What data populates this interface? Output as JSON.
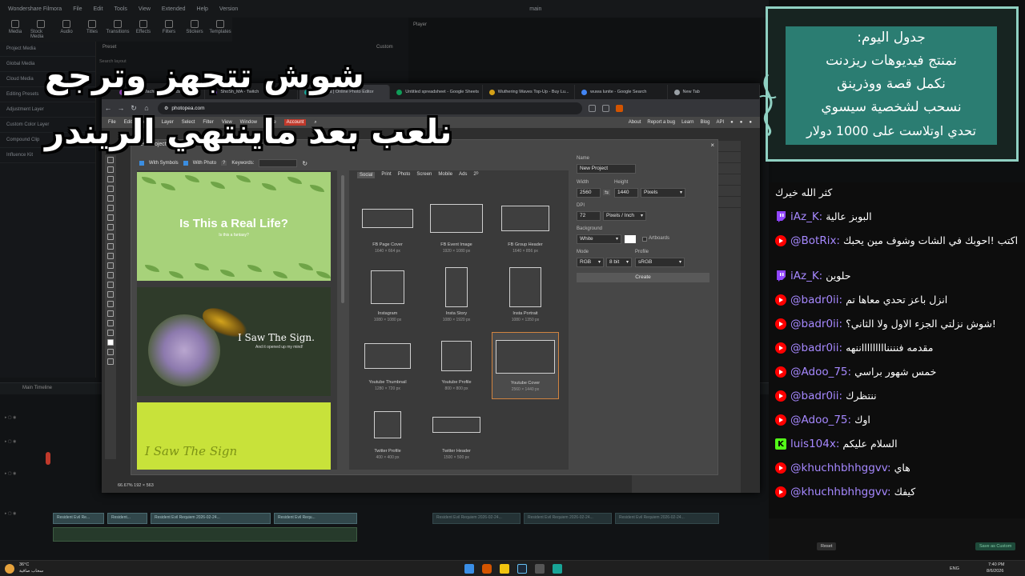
{
  "filmora": {
    "app_name": "Wondershare Filmora",
    "menu": [
      "File",
      "Edit",
      "Tools",
      "View",
      "Extended",
      "Help",
      "Version"
    ],
    "project": "main",
    "tools": [
      "Media",
      "Stock Media",
      "Audio",
      "Titles",
      "Transitions",
      "Effects",
      "Filters",
      "Stickers",
      "Templates"
    ],
    "left_items": [
      "Project Media",
      "Global Media",
      "Cloud Media",
      "Editing Presets",
      "Adjustment Layer",
      "Custom Color Layer",
      "Compound Clip",
      "Influence Kit"
    ],
    "player_label": "Player",
    "preset_label": "Preset",
    "custom_label": "Custom",
    "search_placeholder": "Search layout",
    "timeline_label": "Main Timeline",
    "clips": [
      "Resident Evil Re...",
      "Resident...",
      "Resident Evil Requiem 2026-02-24...",
      "Resident Evil Requ..."
    ],
    "render_button": "Save as Custom",
    "reset_button": "Reset"
  },
  "browser": {
    "tabs": [
      {
        "label": "Loyalty Machine — Clouds...",
        "color": "#8e44ad"
      },
      {
        "label": "ShoSh_MA - Twitch",
        "color": "#9146ff"
      },
      {
        "label": "Photopea | Online Photo Editor",
        "color": "#18a497"
      },
      {
        "label": "Untitled spreadsheet - Google Sheets",
        "color": "#0f9d58"
      },
      {
        "label": "Wuthering Waves Top-Up - Buy Lu...",
        "color": "#d4a017"
      },
      {
        "label": "wuwa lunite - Google Search",
        "color": "#4285f4"
      },
      {
        "label": "New Tab",
        "color": "#9aa0a6"
      }
    ],
    "url": "photopea.com"
  },
  "photopea": {
    "menu": [
      "File",
      "Edit",
      "Image",
      "Layer",
      "Select",
      "Filter",
      "View",
      "Window",
      "More"
    ],
    "account": "Account",
    "right_links": [
      "About",
      "Report a bug",
      "Learn",
      "Blog",
      "API"
    ],
    "status": "66.67%   192 × 563",
    "dialog": {
      "title": "New Project",
      "opt_symbols": "With Symbols",
      "opt_photo": "With Photo",
      "opt_help": "?",
      "keywords_label": "Keywords:",
      "categories": [
        "Social",
        "Print",
        "Photo",
        "Screen",
        "Mobile",
        "Ads",
        "2ᴰ"
      ],
      "templates": [
        {
          "title": "Is This a Real Life?",
          "subtitle": "Is this a fantasy?"
        },
        {
          "title": "I Saw The Sign.",
          "subtitle": "And it opened up my mind!"
        },
        {
          "title": "I Saw The Sign"
        }
      ],
      "presets": [
        {
          "name": "FB Page Cover",
          "size": "1640 × 664 px"
        },
        {
          "name": "FB Event Image",
          "size": "1920 × 1080 px"
        },
        {
          "name": "FB Group Header",
          "size": "1640 × 856 px"
        },
        {
          "name": "Instagram",
          "size": "1080 × 1080 px"
        },
        {
          "name": "Insta Story",
          "size": "1080 × 1920 px"
        },
        {
          "name": "Insta Portrait",
          "size": "1080 × 1350 px"
        },
        {
          "name": "Youtube Thumbnail",
          "size": "1280 × 720 px"
        },
        {
          "name": "Youtube Profile",
          "size": "800 × 800 px"
        },
        {
          "name": "Youtube Cover",
          "size": "2560 × 1440 px"
        },
        {
          "name": "Twitter Profile",
          "size": "400 × 400 px"
        },
        {
          "name": "Twitter Header",
          "size": "1500 × 500 px"
        }
      ],
      "form": {
        "name_label": "Name",
        "name_value": "New Project",
        "width_label": "Width",
        "width_value": "2560",
        "height_label": "Height",
        "height_value": "1440",
        "unit": "Pixels",
        "dpi_label": "DPI",
        "dpi_value": "72",
        "dpi_unit": "Pixels / Inch",
        "bg_label": "Background",
        "bg_value": "White",
        "artboards": "Artboards",
        "mode_label": "Mode",
        "mode_value": "RGB",
        "bit_value": "8 bit",
        "profile_label": "Profile",
        "profile_value": "sRGB",
        "create": "Create"
      }
    }
  },
  "overlay": {
    "line1": "شوش تتجهز وترجع",
    "line2": "نلعب بعد ماينتهي الريندر"
  },
  "schedule": {
    "lines": [
      "جدول اليوم:",
      "نمنتج فيديوهات ريزدنت",
      "نكمل قصة ووذرينق",
      "نسحب لشخصية سيسوي",
      "تحدي اوتلاست على 1000 دولار"
    ]
  },
  "chat": [
    {
      "platform": "none",
      "user": "",
      "text": "كثر الله خيرك"
    },
    {
      "platform": "twitch",
      "user": "iAz_K:",
      "text": "البوبز عالية"
    },
    {
      "platform": "youtube",
      "user": "@BotRix:",
      "text": "اكتب !احوبك في الشات وشوف مين يحبك"
    },
    {
      "platform": "twitch",
      "user": "iAz_K:",
      "text": "حلوين"
    },
    {
      "platform": "youtube",
      "user": "@badr0ii:",
      "text": "انزل باعز تحدي معاها تم"
    },
    {
      "platform": "youtube",
      "user": "@badr0ii:",
      "text": "!شوش نزلتي الجزء الاول ولا الثاني؟"
    },
    {
      "platform": "youtube",
      "user": "@badr0ii:",
      "text": "مقدمه فنننناااااااااننهه"
    },
    {
      "platform": "youtube",
      "user": "@Adoo_75:",
      "text": "خمس شهور براسي"
    },
    {
      "platform": "youtube",
      "user": "@badr0ii:",
      "text": "ننتظرك"
    },
    {
      "platform": "youtube",
      "user": "@Adoo_75:",
      "text": "اوك"
    },
    {
      "platform": "kick",
      "user": "luis104x:",
      "text": "السلام عليكم"
    },
    {
      "platform": "youtube",
      "user": "@khuchhbhhggvv:",
      "text": "هاي"
    },
    {
      "platform": "youtube",
      "user": "@khuchhbhhggvv:",
      "text": "كيفك"
    }
  ],
  "taskbar": {
    "weather_temp": "36°C",
    "weather_desc": "سحاب صافية",
    "lang": "ENG",
    "time": "7:40 PM",
    "date": "8/6/2026"
  }
}
